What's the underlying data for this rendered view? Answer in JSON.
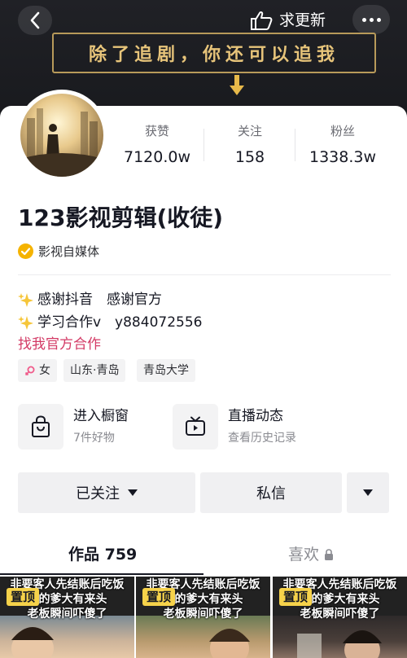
{
  "header": {
    "update_label": "求更新",
    "slogan": "除了追剧，你还可以追我"
  },
  "profile": {
    "stats": [
      {
        "label": "获赞",
        "value": "7120.0w"
      },
      {
        "label": "关注",
        "value": "158"
      },
      {
        "label": "粉丝",
        "value": "1338.3w"
      }
    ],
    "nickname": "123影视剪辑(收徒)",
    "verification": "影视自媒体",
    "bio": {
      "line1": "感谢抖音　感谢官方",
      "line2": "学习合作v　y884072556",
      "link": "找我官方合作"
    },
    "tags": {
      "gender": "女",
      "location": "山东·青岛",
      "school": "青岛大学"
    }
  },
  "shortcuts": [
    {
      "title": "进入橱窗",
      "subtitle": "7件好物"
    },
    {
      "title": "直播动态",
      "subtitle": "查看历史记录"
    }
  ],
  "actions": {
    "follow_label": "已关注",
    "message_label": "私信"
  },
  "tabs": {
    "works_label": "作品 759",
    "likes_label": "喜欢"
  },
  "videos": [
    {
      "caption": "非要客人先结账后吃饭\n子的爹大有来头\n老板瞬间吓傻了",
      "pin": "置顶"
    },
    {
      "caption": "非要客人先结账后吃饭\n子的爹大有来头\n老板瞬间吓傻了",
      "pin": "置顶"
    },
    {
      "caption": "非要客人先结账后吃饭\n子的爹大有来头\n老板瞬间吓傻了",
      "pin": "置顶"
    }
  ],
  "colors": {
    "brand_link": "#d33a65",
    "verify_badge": "#f5b300",
    "slogan_gold": "#e7c47a",
    "pin_badge": "#f6d24a"
  },
  "icons": {
    "back": "chevron-left-icon",
    "hand": "thumbs-up-hand-icon",
    "more": "more-dots-icon",
    "verified": "verified-check-icon",
    "sparkle": "sparkle-icon",
    "female": "female-icon",
    "shop": "shopping-bag-icon",
    "live": "tv-play-icon",
    "lock": "lock-icon"
  }
}
